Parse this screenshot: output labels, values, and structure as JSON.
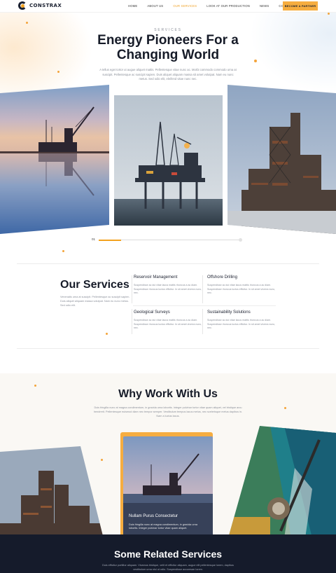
{
  "header": {
    "logo_text": "CONSTRAX",
    "nav": [
      {
        "label": "HOME",
        "active": false
      },
      {
        "label": "ABOUT US",
        "active": false
      },
      {
        "label": "OUR SERVICES",
        "active": true
      },
      {
        "label": "LOOK AT OUR PRODUCTION",
        "active": false
      },
      {
        "label": "NEWS",
        "active": false
      },
      {
        "label": "CONTACT",
        "active": false
      }
    ],
    "cta_label": "BECOME A PARTNER"
  },
  "hero": {
    "eyebrow": "SERVICES",
    "title": "Energy Pioneers For a Changing World",
    "description": "A tellus eget tortor ut augue aliquet mattis. Pellentesque vitae nunc ac. Morbi commodo commodo urna at suscipit. Pellentesque ac suscipit sapien. Duis aliquet aliquam massa sit amet volutpat. Nam eu nunc metus. Sed odio elit, eleifend vitae nunc nec."
  },
  "slider": {
    "current": "01",
    "progress": 0.16
  },
  "services": {
    "title": "Our Services",
    "description": "Venenatis urna at suscipit. Pellentesque ac suscipit sapien. Duis aliquet aliquam massa volutpat. Nam eu nunc metus. Sed odio elit.",
    "items": [
      {
        "title": "Reservoir Management",
        "desc": "Suspendisse ac dui vitae lacus mattis rhoncus a ac diam. Suspendisse rhoncus luctus efficitur. In sit amet viverra nunc, nec."
      },
      {
        "title": "Offshore Drilling",
        "desc": "Suspendisse ac dui vitae lacus mattis rhoncus a ac diam. Suspendisse rhoncus luctus efficitur. In sit amet viverra nunc, nec."
      },
      {
        "title": "Geological Surveys",
        "desc": "Suspendisse ac dui vitae lacus mattis rhoncus a ac diam. Suspendisse rhoncus luctus efficitur. In sit amet viverra nunc, nec."
      },
      {
        "title": "Sustainability Solutions",
        "desc": "Suspendisse ac dui vitae lacus mattis rhoncus a ac diam. Suspendisse rhoncus luctus efficitur. In sit amet viverra nunc, nec."
      }
    ]
  },
  "why": {
    "title": "Why Work With Us",
    "description": "Duis fringilla nunc at magna condimentum, in gravida urna lobortis. Integer pulvinar tortor vitae quam aliquet, vel tristique arcu hendrerit. Pellentesque euismod diam nec tempor semper. Vestibulum tempus lacus metus, nec scelerisque metus dapibus in. Nam a luctus lacus.",
    "featured": {
      "title": "Nullam Purus Consectetur",
      "desc": "Duis fringilla nunc at magna condimentum, in gravida urna lobortis. Integer pulvinar tortor vitae quam aliquet."
    }
  },
  "related": {
    "title": "Some Related Services",
    "description": "Duis efficitur porttitor aliquam. Vivamus tristique, velit et efficitur aliquam, augue elit pellentesque lorem, dapibus vestibulum urna nisi ut odio. Suspendisse accumsan lorem."
  },
  "colors": {
    "accent": "#f3a21f",
    "dark": "#151b2b",
    "text": "#161b28",
    "muted": "#8a8f99"
  }
}
